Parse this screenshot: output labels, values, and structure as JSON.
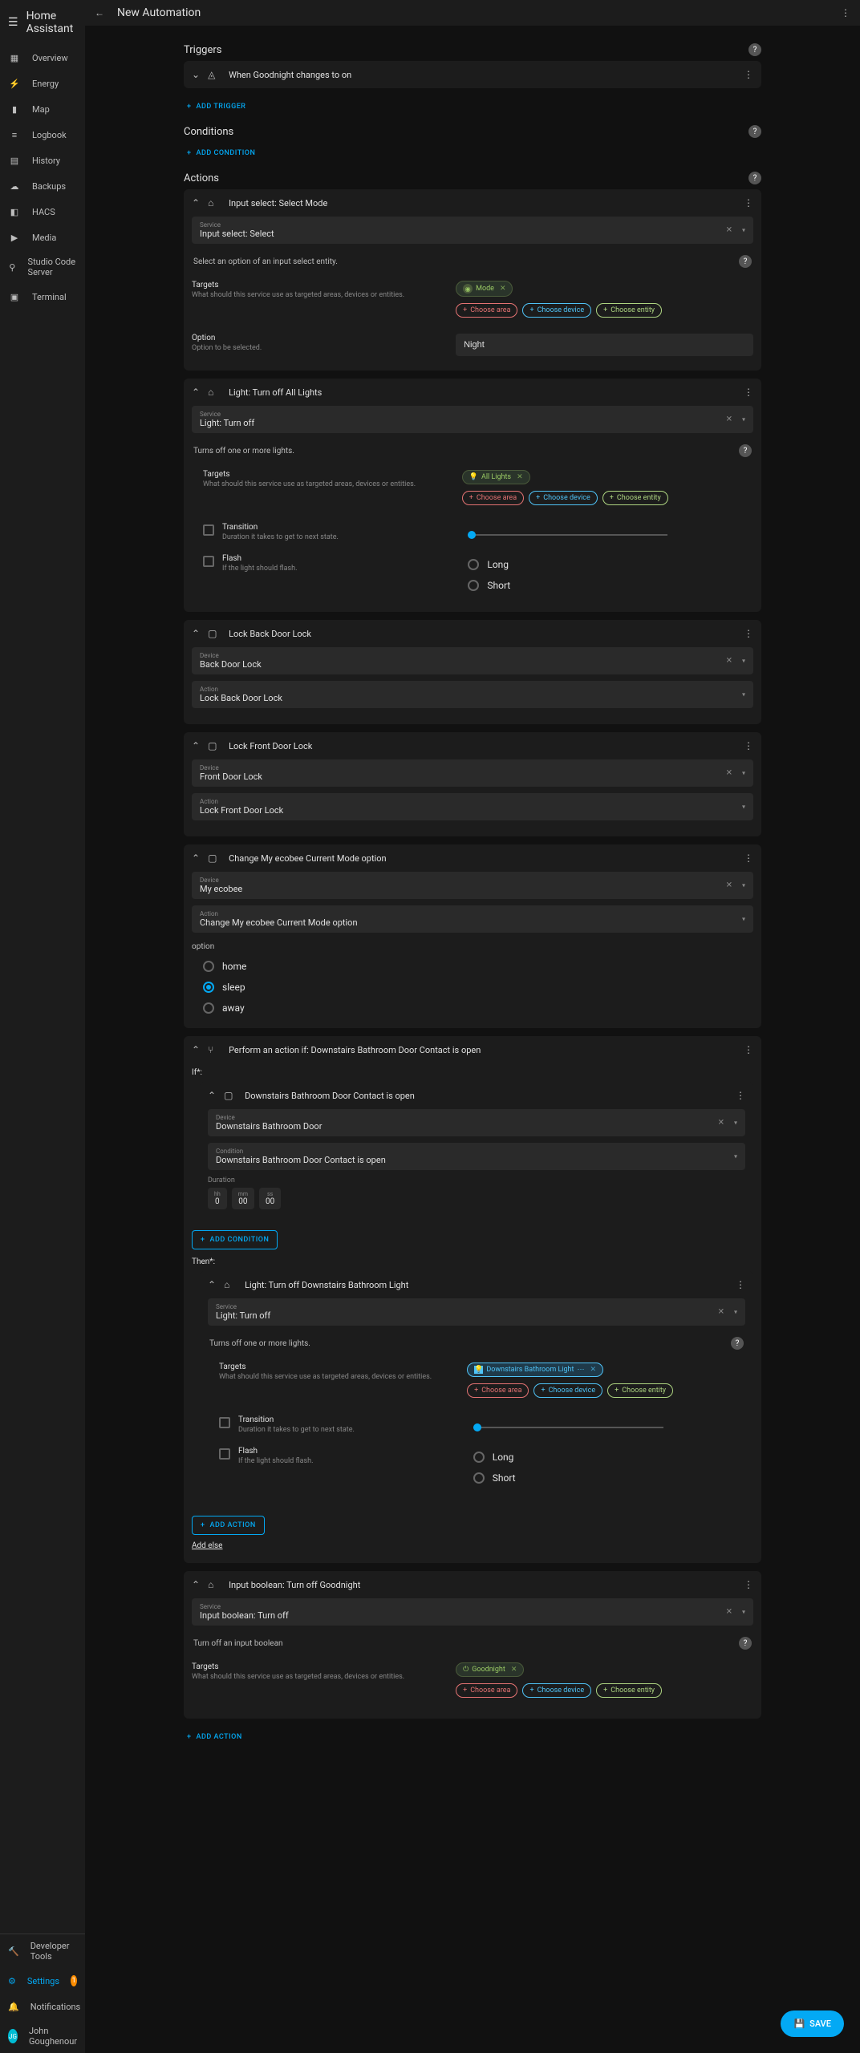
{
  "app": {
    "name": "Home Assistant",
    "page_title": "New Automation"
  },
  "sidebar": {
    "items": [
      {
        "label": "Overview",
        "icon": "dashboard"
      },
      {
        "label": "Energy",
        "icon": "bolt"
      },
      {
        "label": "Map",
        "icon": "map"
      },
      {
        "label": "Logbook",
        "icon": "list"
      },
      {
        "label": "History",
        "icon": "chart"
      },
      {
        "label": "Backups",
        "icon": "cloud"
      },
      {
        "label": "HACS",
        "icon": "hacs"
      },
      {
        "label": "Media",
        "icon": "play"
      },
      {
        "label": "Studio Code Server",
        "icon": "code"
      },
      {
        "label": "Terminal",
        "icon": "terminal"
      }
    ],
    "footer": {
      "dev_tools": "Developer Tools",
      "settings": "Settings",
      "settings_badge": "1",
      "notifications": "Notifications",
      "user": "John Goughenour",
      "user_initials": "JG"
    }
  },
  "sections": {
    "triggers": "Triggers",
    "conditions": "Conditions",
    "actions": "Actions"
  },
  "buttons": {
    "add_trigger": "ADD TRIGGER",
    "add_condition": "ADD CONDITION",
    "add_action": "ADD ACTION",
    "choose_area": "Choose area",
    "choose_device": "Choose device",
    "choose_entity": "Choose entity",
    "save": "SAVE",
    "add_else": "Add else"
  },
  "labels": {
    "service": "Service",
    "device": "Device",
    "action": "Action",
    "condition": "Condition",
    "targets": "Targets",
    "targets_desc": "What should this service use as targeted areas, devices or entities.",
    "option": "Option",
    "option_desc": "Option to be selected.",
    "transition": "Transition",
    "transition_desc": "Duration it takes to get to next state.",
    "flash": "Flash",
    "flash_desc": "If the light should flash.",
    "long": "Long",
    "short": "Short",
    "if_star": "If*:",
    "then_star": "Then*:",
    "duration": "Duration",
    "hh": "hh",
    "mm": "mm",
    "ss": "ss",
    "option_lower": "option",
    "home": "home",
    "sleep": "sleep",
    "away": "away"
  },
  "trigger1": {
    "title": "When Goodnight changes to on"
  },
  "action_select": {
    "title": "Input select: Select Mode",
    "service": "Input select: Select",
    "desc": "Select an option of an input select entity.",
    "chip_mode": "Mode",
    "option_value": "Night"
  },
  "action_lightoff_all": {
    "title": "Light: Turn off All Lights",
    "service": "Light: Turn off",
    "desc": "Turns off one or more lights.",
    "chip": "All Lights"
  },
  "action_lock_back": {
    "title": "Lock Back Door Lock",
    "device": "Back Door Lock",
    "action": "Lock Back Door Lock"
  },
  "action_lock_front": {
    "title": "Lock Front Door Lock",
    "device": "Front Door Lock",
    "action": "Lock Front Door Lock"
  },
  "action_ecobee": {
    "title": "Change My ecobee Current Mode option",
    "device": "My ecobee",
    "action": "Change My ecobee Current Mode option"
  },
  "action_if": {
    "title": "Perform an action if: Downstairs Bathroom Door Contact is open",
    "cond_title": "Downstairs Bathroom Door Contact is open",
    "cond_device": "Downstairs Bathroom Door",
    "cond_condition": "Downstairs Bathroom Door Contact is open",
    "dur_h": "0",
    "dur_m": "00",
    "dur_s": "00",
    "then_title": "Light: Turn off Downstairs Bathroom Light",
    "then_service": "Light: Turn off",
    "then_desc": "Turns off one or more lights.",
    "chip_dbl": "Downstairs Bathroom Light"
  },
  "action_bool": {
    "title": "Input boolean: Turn off Goodnight",
    "service": "Input boolean: Turn off",
    "desc": "Turn off an input boolean",
    "chip": "Goodnight"
  }
}
